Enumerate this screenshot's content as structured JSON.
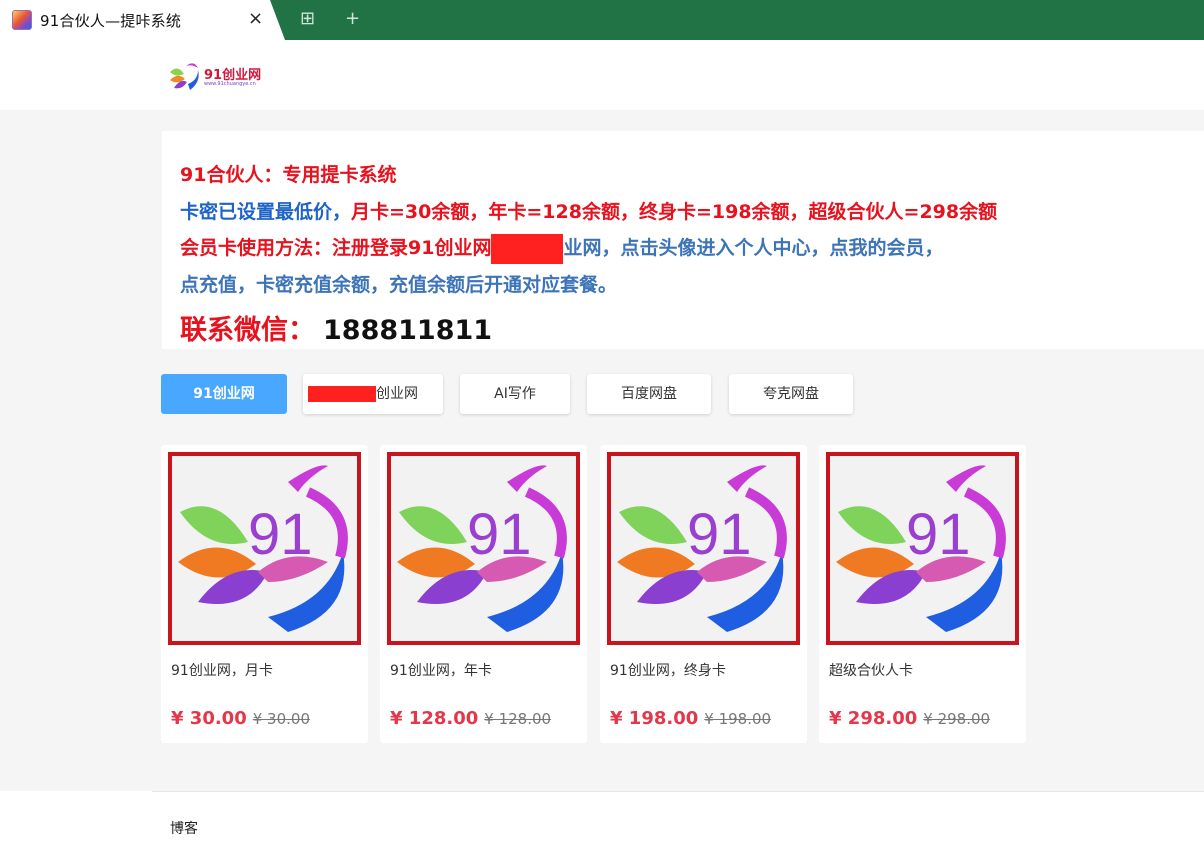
{
  "browser": {
    "tab_title": "91合伙人—提咔系统",
    "close_icon": "×",
    "new_tab_icon": "+",
    "extension_icon": "⊞"
  },
  "header": {
    "logo_text": "91创业网",
    "logo_url": "www.91chuangye.cn"
  },
  "notice": {
    "line1": "91合伙人：专用提卡系统",
    "line2_prefix": "卡密已设置最低价，",
    "line2_rest": "月卡=30余额，年卡=128余额，终身卡=198余额，超级合伙人=298余额",
    "line3_prefix": "会员卡使用方法：注册登录91创业网",
    "line3_after_redact": "业网，",
    "line3_rest": "点击头像进入个人中心，点我的会员，",
    "line4": "点充值，卡密充值余额，充值余额后开通对应套餐。",
    "contact_label": "联系微信：",
    "contact_number": "188811811"
  },
  "categories": [
    {
      "label": "91创业网"
    },
    {
      "label": "创业网"
    },
    {
      "label": "AI写作"
    },
    {
      "label": "百度网盘"
    },
    {
      "label": "夸克网盘"
    }
  ],
  "products": [
    {
      "name": "91创业网，月卡",
      "price": "¥ 30.00",
      "old_price": "¥ 30.00"
    },
    {
      "name": "91创业网，年卡",
      "price": "¥ 128.00",
      "old_price": "¥ 128.00"
    },
    {
      "name": "91创业网，终身卡",
      "price": "¥ 198.00",
      "old_price": "¥ 198.00"
    },
    {
      "name": "超级合伙人卡",
      "price": "¥ 298.00",
      "old_price": "¥ 298.00"
    }
  ],
  "product_badge_text": "91",
  "footer": {
    "link": "博客"
  },
  "colors": {
    "tabbar": "#217346",
    "accent_blue": "#4aa7ff",
    "price_red": "#e6364a",
    "border_red": "#c8141c"
  }
}
